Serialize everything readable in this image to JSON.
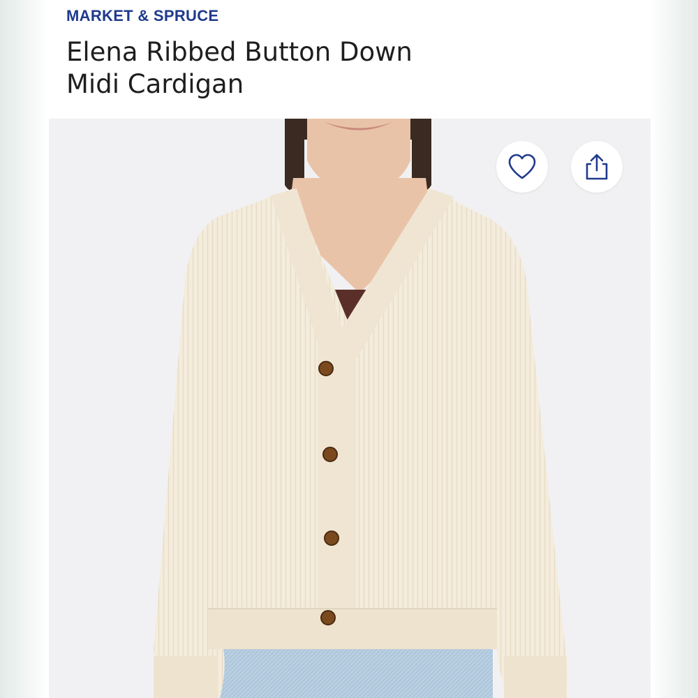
{
  "product": {
    "brand": "MARKET & SPRUCE",
    "title_line1": "Elena Ribbed Button Down",
    "title_line2": "Midi Cardigan"
  },
  "actions": {
    "favorite_icon": "heart-outline-icon",
    "share_icon": "share-upload-icon"
  },
  "colors": {
    "brand": "#1f3a8c",
    "title": "#1e1e1e",
    "image_background": "#f1f1f3",
    "cardigan": "#f4ecdc",
    "undershirt": "#5a2f29",
    "denim": "#b7cde0",
    "buttons": "#7a4a1e"
  }
}
